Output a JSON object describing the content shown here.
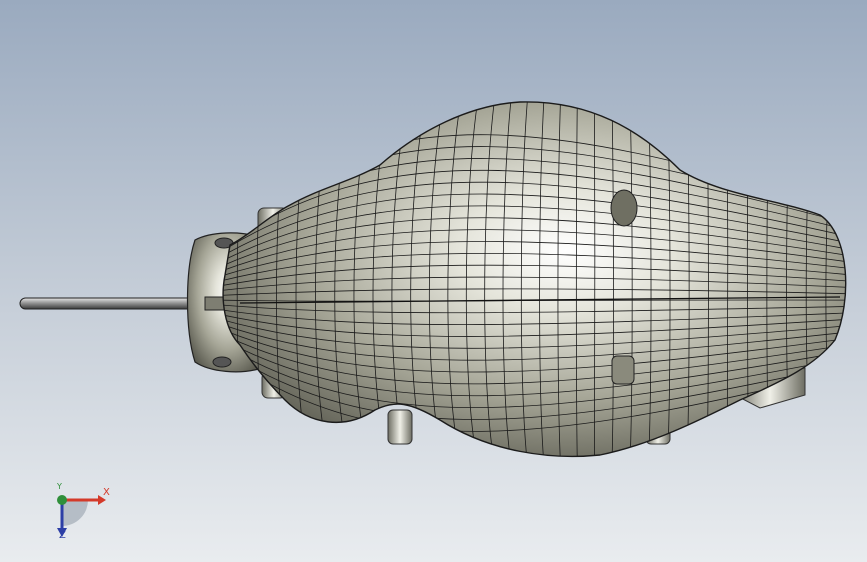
{
  "viewport": {
    "background_top": "#9aaabf",
    "background_bottom": "#e9ecef"
  },
  "model": {
    "shell_color": "#d8d8cc",
    "mesh_line_color": "#1a1a1a",
    "rod_color": "#c9c9c9"
  },
  "triad": {
    "x_label": "X",
    "y_label": "Y",
    "z_label": "Z",
    "x_color": "#d43a2a",
    "y_color": "#2f8f3a",
    "z_color": "#2d3fa6"
  }
}
